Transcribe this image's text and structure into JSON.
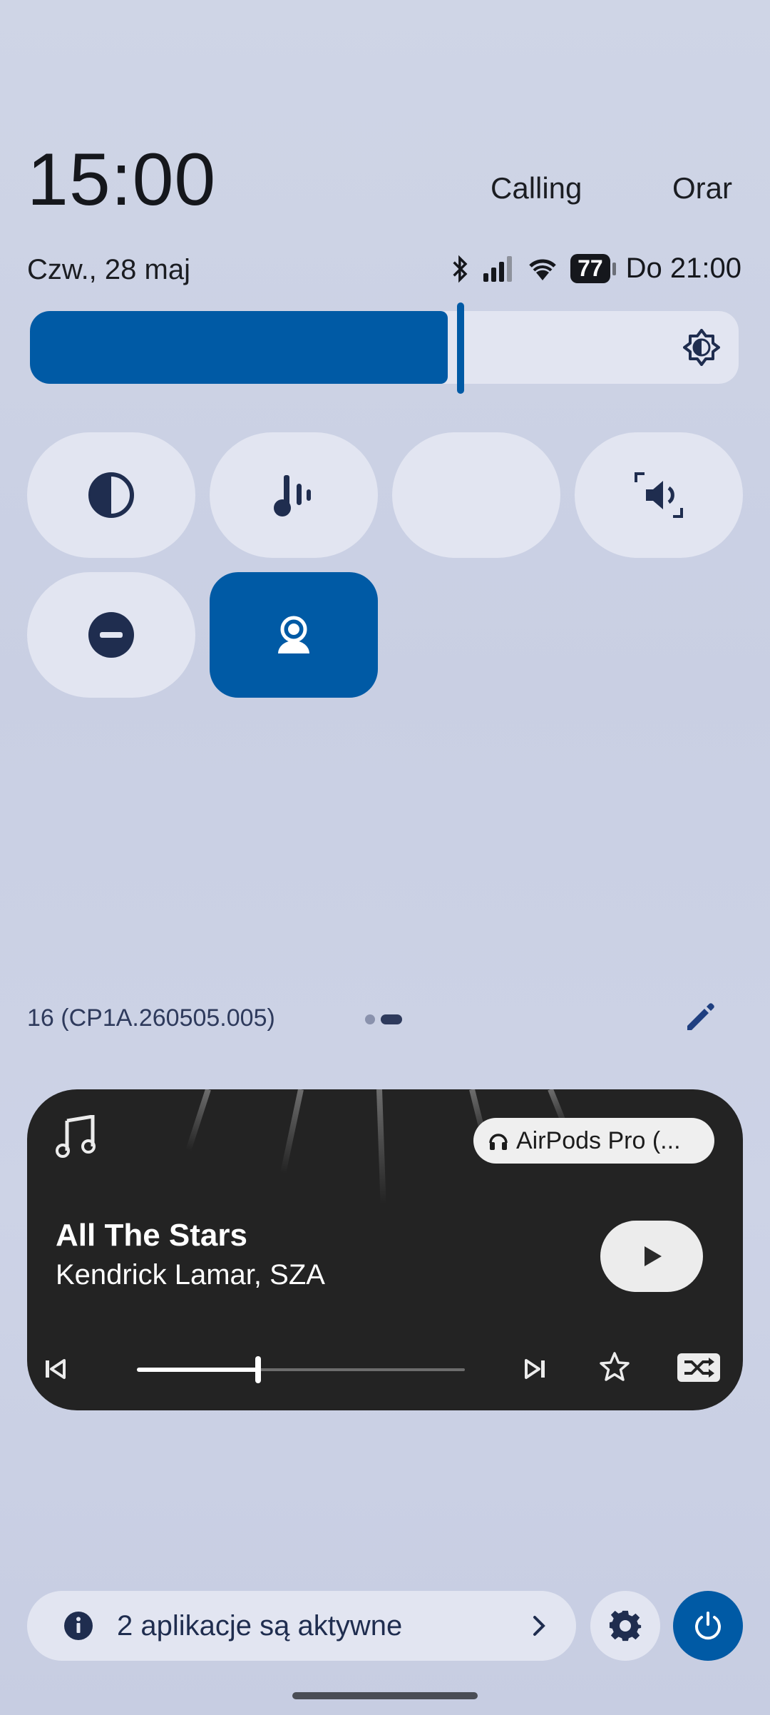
{
  "header": {
    "time": "15:00",
    "pill_calling": "Calling",
    "pill_orar": "Orar"
  },
  "status_bar": {
    "date": "Czw., 28 maj",
    "battery": "77",
    "battery_time": "Do 21:00"
  },
  "brightness": {
    "level": 0.59
  },
  "quick_tiles": [
    {
      "name": "contrast",
      "active": false
    },
    {
      "name": "sound",
      "active": false
    },
    {
      "name": "dark-mode",
      "active": false
    },
    {
      "name": "volume",
      "active": false
    },
    {
      "name": "do-not-disturb",
      "active": false
    },
    {
      "name": "user",
      "active": true
    }
  ],
  "footer": {
    "build": "16 (CP1A.260505.005)"
  },
  "media": {
    "device": "AirPods Pro (...",
    "title": "All The Stars",
    "artist": "Kendrick Lamar, SZA",
    "progress": 0.37
  },
  "bottom": {
    "active_apps": "2 aplikacje są aktywne"
  },
  "colors": {
    "accent": "#005aa5",
    "tile_bg": "#e2e5f1",
    "icon": "#1f2d4f",
    "media_bg": "#232323"
  }
}
